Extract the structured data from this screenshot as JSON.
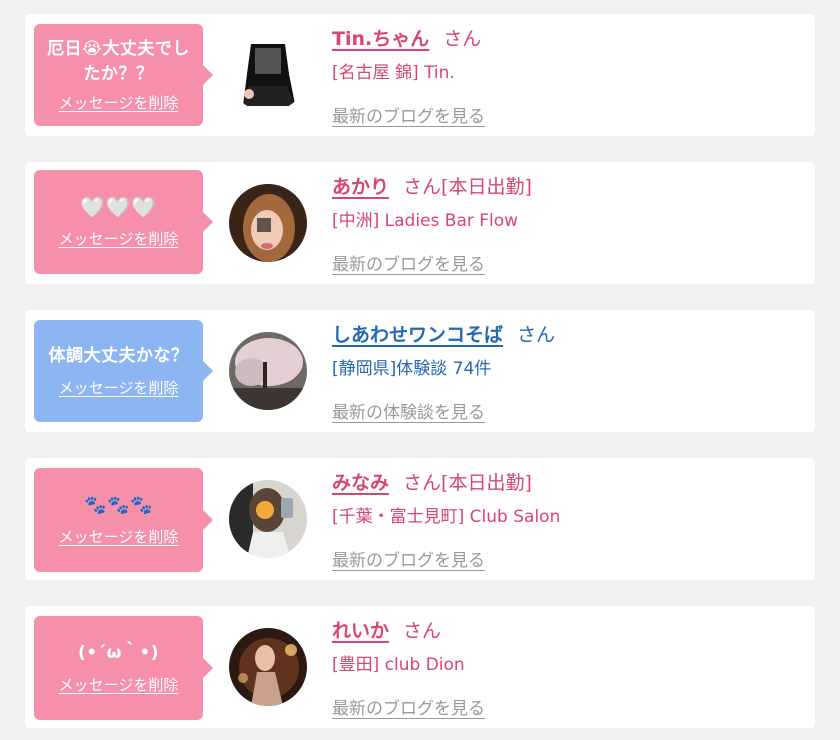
{
  "colors": {
    "pink_accent": "#d9466d",
    "blue_accent": "#2368b3",
    "pink_bubble": "#f68faa",
    "blue_bubble": "#8db5f2"
  },
  "items": [
    {
      "message": "厄日😭大丈夫でしたか？？",
      "delete_label": "メッセージを削除",
      "name": "Tin.ちゃん",
      "honorific": "さん",
      "status": "",
      "shop": "[名古屋 錦] Tin.",
      "link": "最新のブログを見る"
    },
    {
      "message": "🤍🤍🤍",
      "delete_label": "メッセージを削除",
      "name": "あかり",
      "honorific": "さん",
      "status": "[本日出勤]",
      "shop": "[中洲] Ladies Bar Flow",
      "link": "最新のブログを見る"
    },
    {
      "message": "体調大丈夫かな？",
      "delete_label": "メッセージを削除",
      "name": "しあわせワンコそば",
      "honorific": "さん",
      "status": "",
      "shop": "[静岡県]体験談 74件",
      "link": "最新の体験談を見る"
    },
    {
      "message": "🐾🐾🐾",
      "delete_label": "メッセージを削除",
      "name": "みなみ",
      "honorific": "さん",
      "status": "[本日出勤]",
      "shop": "[千葉・富士見町] Club Salon",
      "link": "最新のブログを見る"
    },
    {
      "message": "(•´ω｀•)",
      "delete_label": "メッセージを削除",
      "name": "れいか",
      "honorific": "さん",
      "status": "",
      "shop": "[豊田] club Dion",
      "link": "最新のブログを見る"
    }
  ]
}
